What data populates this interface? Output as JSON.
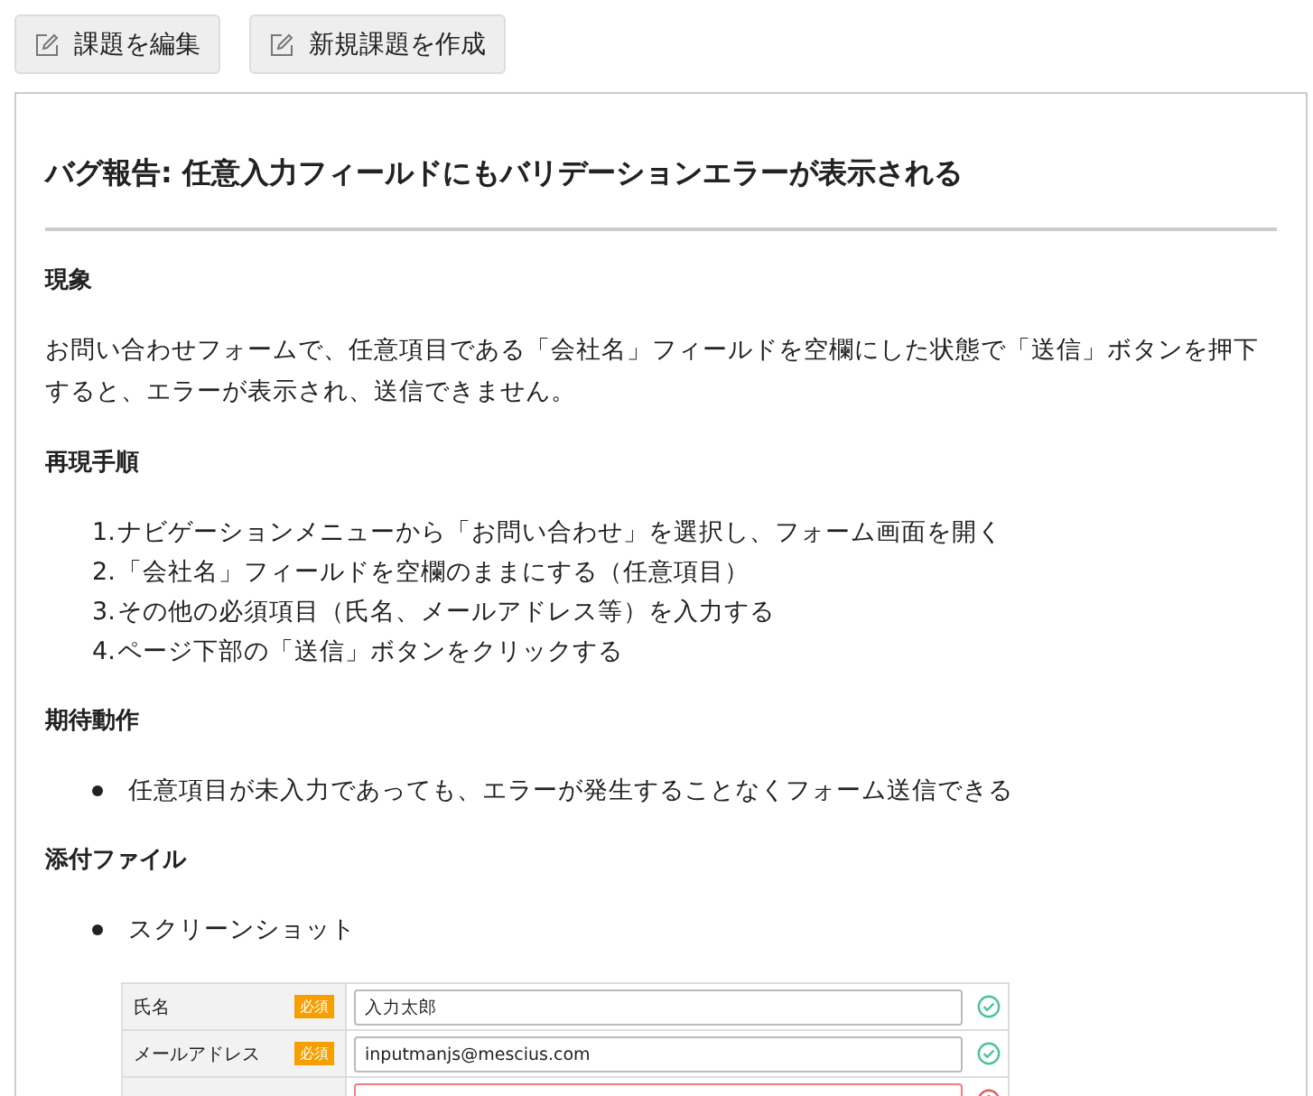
{
  "toolbar": {
    "buttons": [
      {
        "label": "課題を編集"
      },
      {
        "label": "新規課題を作成"
      }
    ]
  },
  "issue": {
    "title": "バグ報告: 任意入力フィールドにもバリデーションエラーが表示される",
    "sections": [
      {
        "heading": "現象",
        "kind": "paragraph",
        "text": "お問い合わせフォームで、任意項目である「会社名」フィールドを空欄にした状態で「送信」ボタンを押下すると、エラーが表示され、送信できません。"
      },
      {
        "heading": "再現手順",
        "kind": "ordered",
        "items": [
          "ナビゲーションメニューから「お問い合わせ」を選択し、フォーム画面を開く",
          "「会社名」フィールドを空欄のままにする（任意項目）",
          "その他の必須項目（氏名、メールアドレス等）を入力する",
          "ページ下部の「送信」ボタンをクリックする"
        ],
        "numbers": [
          "1.",
          "2.",
          "3.",
          "4."
        ]
      },
      {
        "heading": "期待動作",
        "kind": "bullets",
        "items": [
          "任意項目が未入力であっても、エラーが発生することなくフォーム送信できる"
        ]
      },
      {
        "heading": "添付ファイル",
        "kind": "bullets",
        "items": [
          "スクリーンショット"
        ]
      }
    ],
    "screenshot": {
      "rows": [
        {
          "label": "氏名",
          "badge": "必須",
          "value": "入力太郎",
          "valid": true
        },
        {
          "label": "メールアドレス",
          "badge": "必須",
          "value": "inputmanjs@mescius.com",
          "valid": true
        },
        {
          "valid": false
        }
      ]
    }
  }
}
